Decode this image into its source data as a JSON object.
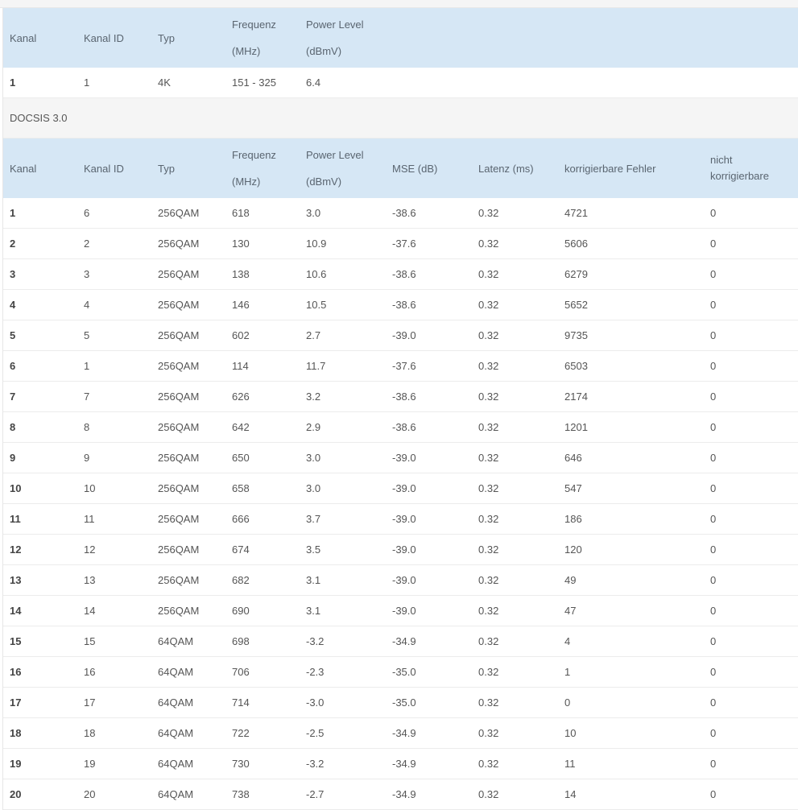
{
  "ofdm": {
    "headers": [
      "Kanal",
      "Kanal ID",
      "Typ",
      "Frequenz\n(MHz)",
      "Power Level\n(dBmV)"
    ],
    "rows": [
      [
        "1",
        "1",
        "4K",
        "151 - 325",
        "6.4"
      ]
    ]
  },
  "docsis30": {
    "title": "DOCSIS 3.0",
    "headers": [
      "Kanal",
      "Kanal ID",
      "Typ",
      "Frequenz\n(MHz)",
      "Power Level\n(dBmV)",
      "MSE (dB)",
      "Latenz (ms)",
      "korrigierbare Fehler",
      "nicht korrigierbare"
    ],
    "rows": [
      [
        "1",
        "6",
        "256QAM",
        "618",
        "3.0",
        "-38.6",
        "0.32",
        "4721",
        "0"
      ],
      [
        "2",
        "2",
        "256QAM",
        "130",
        "10.9",
        "-37.6",
        "0.32",
        "5606",
        "0"
      ],
      [
        "3",
        "3",
        "256QAM",
        "138",
        "10.6",
        "-38.6",
        "0.32",
        "6279",
        "0"
      ],
      [
        "4",
        "4",
        "256QAM",
        "146",
        "10.5",
        "-38.6",
        "0.32",
        "5652",
        "0"
      ],
      [
        "5",
        "5",
        "256QAM",
        "602",
        "2.7",
        "-39.0",
        "0.32",
        "9735",
        "0"
      ],
      [
        "6",
        "1",
        "256QAM",
        "114",
        "11.7",
        "-37.6",
        "0.32",
        "6503",
        "0"
      ],
      [
        "7",
        "7",
        "256QAM",
        "626",
        "3.2",
        "-38.6",
        "0.32",
        "2174",
        "0"
      ],
      [
        "8",
        "8",
        "256QAM",
        "642",
        "2.9",
        "-38.6",
        "0.32",
        "1201",
        "0"
      ],
      [
        "9",
        "9",
        "256QAM",
        "650",
        "3.0",
        "-39.0",
        "0.32",
        "646",
        "0"
      ],
      [
        "10",
        "10",
        "256QAM",
        "658",
        "3.0",
        "-39.0",
        "0.32",
        "547",
        "0"
      ],
      [
        "11",
        "11",
        "256QAM",
        "666",
        "3.7",
        "-39.0",
        "0.32",
        "186",
        "0"
      ],
      [
        "12",
        "12",
        "256QAM",
        "674",
        "3.5",
        "-39.0",
        "0.32",
        "120",
        "0"
      ],
      [
        "13",
        "13",
        "256QAM",
        "682",
        "3.1",
        "-39.0",
        "0.32",
        "49",
        "0"
      ],
      [
        "14",
        "14",
        "256QAM",
        "690",
        "3.1",
        "-39.0",
        "0.32",
        "47",
        "0"
      ],
      [
        "15",
        "15",
        "64QAM",
        "698",
        "-3.2",
        "-34.9",
        "0.32",
        "4",
        "0"
      ],
      [
        "16",
        "16",
        "64QAM",
        "706",
        "-2.3",
        "-35.0",
        "0.32",
        "1",
        "0"
      ],
      [
        "17",
        "17",
        "64QAM",
        "714",
        "-3.0",
        "-35.0",
        "0.32",
        "0",
        "0"
      ],
      [
        "18",
        "18",
        "64QAM",
        "722",
        "-2.5",
        "-34.9",
        "0.32",
        "10",
        "0"
      ],
      [
        "19",
        "19",
        "64QAM",
        "730",
        "-3.2",
        "-34.9",
        "0.32",
        "11",
        "0"
      ],
      [
        "20",
        "20",
        "64QAM",
        "738",
        "-2.7",
        "-34.9",
        "0.32",
        "14",
        "0"
      ]
    ]
  }
}
